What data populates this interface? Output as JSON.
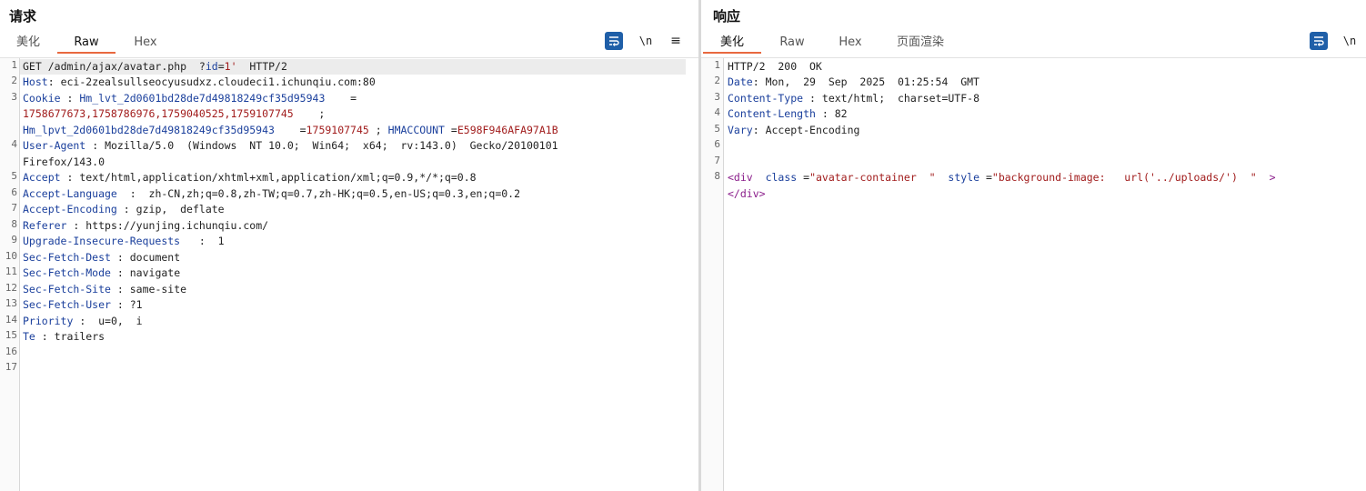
{
  "request": {
    "title": "请求",
    "tabs": [
      {
        "label": "美化",
        "active": false
      },
      {
        "label": "Raw",
        "active": true
      },
      {
        "label": "Hex",
        "active": false
      }
    ],
    "toolbar": {
      "newline_label": "\\n",
      "menu_label": "≡"
    },
    "line_numbers": [
      "1",
      "2",
      "3",
      "4",
      "5",
      "6",
      "7",
      "8",
      "9",
      "10",
      "11",
      "12",
      "13",
      "14",
      "15",
      "16",
      "17"
    ],
    "lines": {
      "l1": {
        "method": "GET",
        "path": "/admin/ajax/avatar.php",
        "q_mark": "?",
        "param_key": "id",
        "eq": "=",
        "param_val": "1'",
        "proto": "HTTP/2"
      },
      "l2": {
        "key": "Host",
        "sep": ":",
        "val": "eci-2zealsullseocyusudxz.cloudeci1.ichunqiu.com:80"
      },
      "l3": {
        "key": "Cookie",
        "sep": ":",
        "c1_name": "Hm_lvt_2d0601bd28de7d49818249cf35d95943",
        "c1_eq": "=",
        "c1_val": "1758677673,1758786976,1759040525,1759107745",
        "semi": ";",
        "c2_name": "Hm_lpvt_2d0601bd28de7d49818249cf35d95943",
        "c2_eq": "=",
        "c2_val": "1759107745",
        "semi2": ";",
        "c3_name": "HMACCOUNT",
        "c3_eq": "=",
        "c3_val": "E598F946AFA97A1B"
      },
      "l4": {
        "key": "User-Agent",
        "sep": ":",
        "val": "Mozilla/5.0  (Windows  NT 10.0;  Win64;  x64;  rv:143.0)  Gecko/20100101",
        "val_cont": "Firefox/143.0"
      },
      "l5": {
        "key": "Accept",
        "sep": ":",
        "val": "text/html,application/xhtml+xml,application/xml;q=0.9,*/*;q=0.8"
      },
      "l6": {
        "key": "Accept-Language",
        "sep": ":",
        "val": "zh-CN,zh;q=0.8,zh-TW;q=0.7,zh-HK;q=0.5,en-US;q=0.3,en;q=0.2"
      },
      "l7": {
        "key": "Accept-Encoding",
        "sep": ":",
        "val": "gzip,  deflate"
      },
      "l8": {
        "key": "Referer",
        "sep": ":",
        "val": "https://yunjing.ichunqiu.com/"
      },
      "l9": {
        "key": "Upgrade-Insecure-Requests",
        "sep": ":",
        "val": "1"
      },
      "l10": {
        "key": "Sec-Fetch-Dest",
        "sep": ":",
        "val": "document"
      },
      "l11": {
        "key": "Sec-Fetch-Mode",
        "sep": ":",
        "val": "navigate"
      },
      "l12": {
        "key": "Sec-Fetch-Site",
        "sep": ":",
        "val": "same-site"
      },
      "l13": {
        "key": "Sec-Fetch-User",
        "sep": ":",
        "val": "?1"
      },
      "l14": {
        "key": "Priority",
        "sep": ":",
        "val": "u=0,  i"
      },
      "l15": {
        "key": "Te",
        "sep": ":",
        "val": "trailers"
      }
    }
  },
  "response": {
    "title": "响应",
    "tabs": [
      {
        "label": "美化",
        "active": true
      },
      {
        "label": "Raw",
        "active": false
      },
      {
        "label": "Hex",
        "active": false
      },
      {
        "label": "页面渲染",
        "active": false
      }
    ],
    "toolbar": {
      "newline_label": "\\n"
    },
    "line_numbers": [
      "1",
      "2",
      "3",
      "4",
      "5",
      "6",
      "7",
      "8"
    ],
    "lines": {
      "l1": {
        "text": "HTTP/2  200  OK"
      },
      "l2": {
        "key": "Date",
        "sep": ":",
        "val": "Mon,  29  Sep  2025  01:25:54  GMT"
      },
      "l3": {
        "key": "Content-Type",
        "sep": ":",
        "val": "text/html;  charset=UTF-8"
      },
      "l4": {
        "key": "Content-Length",
        "sep": ":",
        "val": "82"
      },
      "l5": {
        "key": "Vary",
        "sep": ":",
        "val": "Accept-Encoding"
      },
      "l8": {
        "open_tag": "<div",
        "attr1": "class",
        "eq1": "=",
        "val1": "\"avatar-container  \"",
        "attr2": "style",
        "eq2": "=",
        "val2": "\"background-image:   url('../uploads/')  \"",
        "close": ">",
        "end_tag": "</div>"
      }
    }
  },
  "colors": {
    "accent_tab": "#e8693f",
    "header_key": "#1a3f9c",
    "cookie_value": "#a11c1c",
    "button_blue": "#1f5fa8"
  }
}
